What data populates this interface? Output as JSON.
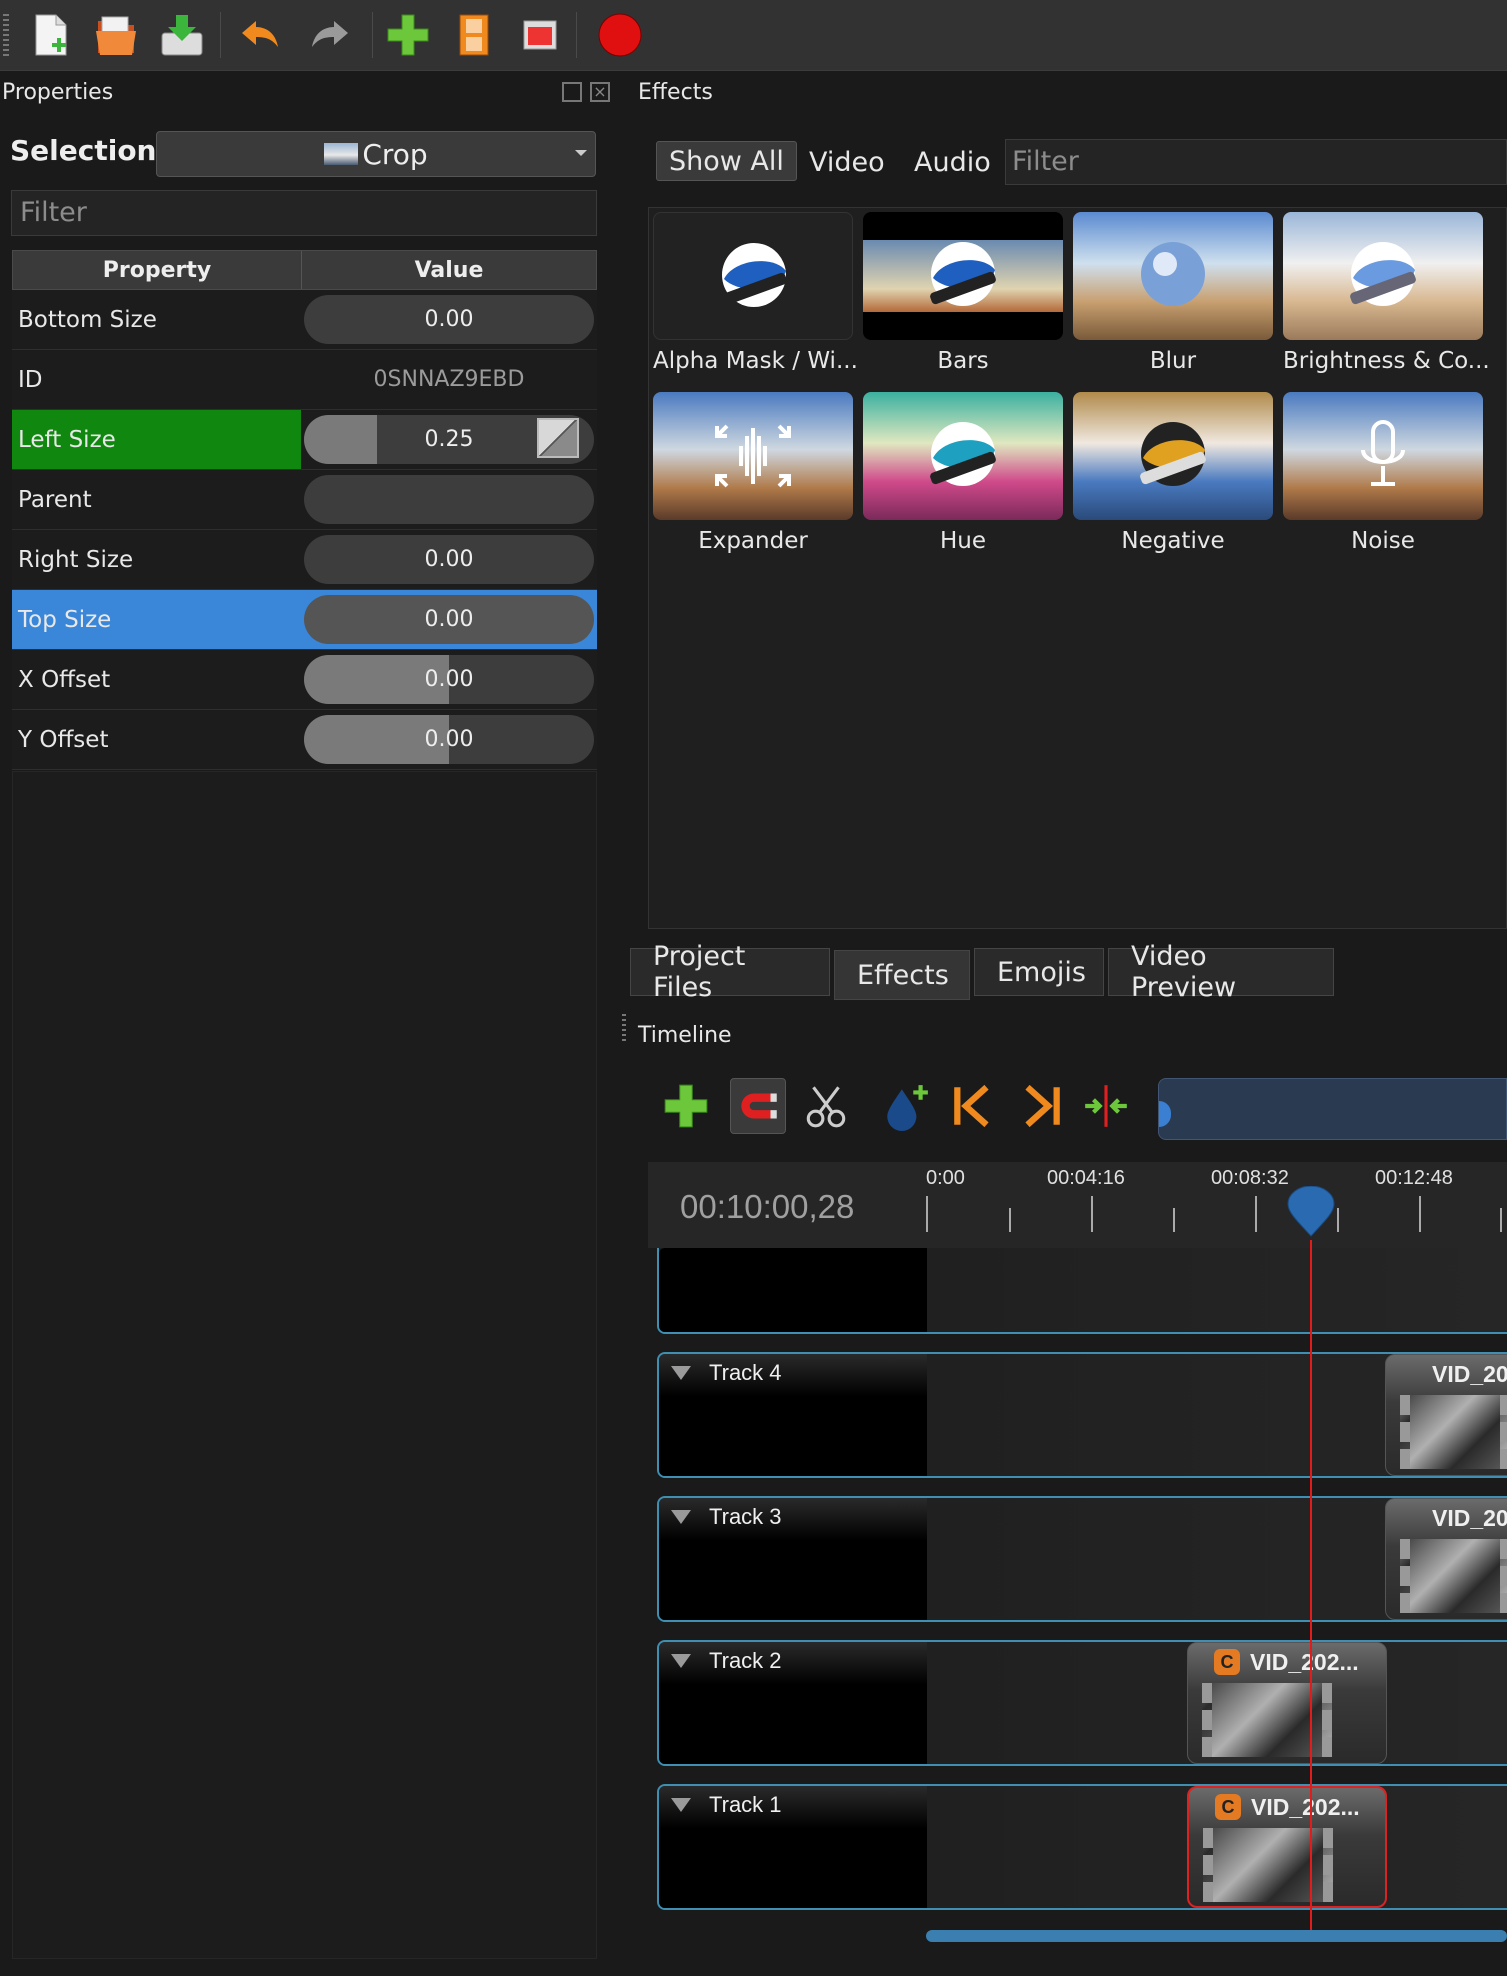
{
  "toolbar": {
    "buttons": [
      "new-project",
      "open-project",
      "save-project",
      "undo",
      "redo",
      "import-files",
      "choose-profile",
      "fullscreen",
      "export-video"
    ]
  },
  "properties": {
    "title": "Properties",
    "selection_label": "Selection:",
    "selection_value": "Crop",
    "filter_placeholder": "Filter",
    "columns": [
      "Property",
      "Value"
    ],
    "rows": [
      {
        "name": "Bottom Size",
        "value": "0.00",
        "fill": 0.0
      },
      {
        "name": "ID",
        "value": "0SNNAZ9EBD"
      },
      {
        "name": "Left Size",
        "value": "0.25",
        "fill": 0.25
      },
      {
        "name": "Parent",
        "value": ""
      },
      {
        "name": "Right Size",
        "value": "0.00",
        "fill": 0.0
      },
      {
        "name": "Top Size",
        "value": "0.00",
        "fill": 0.0
      },
      {
        "name": "X Offset",
        "value": "0.00",
        "fill": 0.5
      },
      {
        "name": "Y Offset",
        "value": "0.00",
        "fill": 0.5
      }
    ]
  },
  "effects": {
    "title": "Effects",
    "tabs": [
      "Show All",
      "Video",
      "Audio"
    ],
    "filter_placeholder": "Filter",
    "items": [
      "Alpha Mask / Wi...",
      "Bars",
      "Blur",
      "Brightness & Co...",
      "Expander",
      "Hue",
      "Negative",
      "Noise"
    ]
  },
  "bottom_tabs": [
    "Project Files",
    "Effects",
    "Emojis",
    "Video Preview"
  ],
  "timeline": {
    "title": "Timeline",
    "timecode": "00:10:00,28",
    "ticks": [
      "0:00",
      "00:04:16",
      "00:08:32",
      "00:12:48"
    ],
    "tracks": [
      {
        "name": "Track 4",
        "clip": "VID_20"
      },
      {
        "name": "Track 3",
        "clip": "VID_20"
      },
      {
        "name": "Track 2",
        "clip": "VID_202..."
      },
      {
        "name": "Track 1",
        "clip": "VID_202..."
      }
    ],
    "clip_badge": "C"
  },
  "colors": {
    "selected_row": "#3a86d8",
    "keyframe_row": "#10880f",
    "playhead": "#e21b1b"
  }
}
